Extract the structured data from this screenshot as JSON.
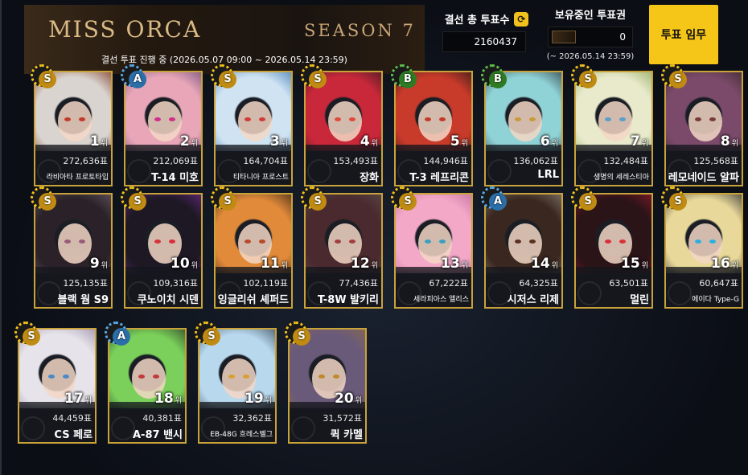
{
  "banner": {
    "logo": "MISS ORCA",
    "season": "SEASON 7",
    "period": "결선 투표 진행 중 (2026.05.07 09:00 ~ 2026.05.14 23:59)"
  },
  "totals": {
    "label": "결선 총 투표수",
    "value": "2160437"
  },
  "tickets": {
    "label": "보유중인 투표권",
    "count": "0",
    "expiry": "(~ 2026.05.14 23:59)"
  },
  "mission_button": "투표 임무",
  "rank_suffix": "위",
  "candidates": [
    {
      "rank": "1",
      "votes": "272,636표",
      "name": "라비아타 프로토타입",
      "grade": "S",
      "hair": "#d9d4cf",
      "accent": "#7a3520",
      "eye": "#c23a2a"
    },
    {
      "rank": "2",
      "votes": "212,069표",
      "name": "T-14 미호",
      "grade": "A",
      "hair": "#e8a6b8",
      "accent": "#6b4a7a",
      "eye": "#d02f8a"
    },
    {
      "rank": "3",
      "votes": "164,704표",
      "name": "티타니아 프로스트",
      "grade": "S",
      "hair": "#cfe3f3",
      "accent": "#3d78b0",
      "eye": "#d03a3a"
    },
    {
      "rank": "4",
      "votes": "153,493표",
      "name": "장화",
      "grade": "S",
      "hair": "#c8283a",
      "accent": "#3a1a22",
      "eye": "#e04a3a"
    },
    {
      "rank": "5",
      "votes": "144,946표",
      "name": "T-3 레프리콘",
      "grade": "B",
      "hair": "#c83a2a",
      "accent": "#2a1a16",
      "eye": "#c43a2a"
    },
    {
      "rank": "6",
      "votes": "136,062표",
      "name": "LRL",
      "grade": "B",
      "hair": "#8fd3d6",
      "accent": "#2c3a40",
      "eye": "#c89a3a"
    },
    {
      "rank": "7",
      "votes": "132,484표",
      "name": "생명의 세레스티아",
      "grade": "S",
      "hair": "#e8eacb",
      "accent": "#8fa85a",
      "eye": "#5aa0c8"
    },
    {
      "rank": "8",
      "votes": "125,568표",
      "name": "레모네이드 알파",
      "grade": "S",
      "hair": "#7b4a6a",
      "accent": "#3a2a2e",
      "eye": "#7a3a3a"
    },
    {
      "rank": "9",
      "votes": "125,135표",
      "name": "블랙 웜 S9",
      "grade": "S",
      "hair": "#2a2228",
      "accent": "#6a5a66",
      "eye": "#9a5a7a"
    },
    {
      "rank": "10",
      "votes": "109,316표",
      "name": "쿠노이치 시덴",
      "grade": "S",
      "hair": "#1e1824",
      "accent": "#6a2a8a",
      "eye": "#d8303a"
    },
    {
      "rank": "11",
      "votes": "102,119표",
      "name": "잉글리쉬 셰퍼드",
      "grade": "S",
      "hair": "#e08a3a",
      "accent": "#3a2418",
      "eye": "#b84a2a"
    },
    {
      "rank": "12",
      "votes": "77,436표",
      "name": "T-8W 발키리",
      "grade": "S",
      "hair": "#4a2a2e",
      "accent": "#5a4a4a",
      "eye": "#a04040"
    },
    {
      "rank": "13",
      "votes": "67,222표",
      "name": "세라피아스 앨리스",
      "grade": "S",
      "hair": "#f3a8c8",
      "accent": "#c06a9a",
      "eye": "#3aa0c0"
    },
    {
      "rank": "14",
      "votes": "64,325표",
      "name": "시저스 리제",
      "grade": "A",
      "hair": "#3a2820",
      "accent": "#8a8070",
      "eye": "#5a3020"
    },
    {
      "rank": "15",
      "votes": "63,501표",
      "name": "멀린",
      "grade": "S",
      "hair": "#2a1418",
      "accent": "#8a1a2a",
      "eye": "#d8303a"
    },
    {
      "rank": "16",
      "votes": "60,647표",
      "name": "에이다 Type-G",
      "grade": "S",
      "hair": "#e8d89a",
      "accent": "#2a2a2e",
      "eye": "#2ab0e0"
    },
    {
      "rank": "17",
      "votes": "44,459표",
      "name": "CS 페로",
      "grade": "S",
      "hair": "#e6e4ea",
      "accent": "#9a8aaa",
      "eye": "#4a88c8"
    },
    {
      "rank": "18",
      "votes": "40,381표",
      "name": "A-87 밴시",
      "grade": "A",
      "hair": "#7ad05a",
      "accent": "#2a3a24",
      "eye": "#c03a3a"
    },
    {
      "rank": "19",
      "votes": "32,362표",
      "name": "EB-48G 흐레스벨그",
      "grade": "S",
      "hair": "#b8d8ee",
      "accent": "#3a4a5a",
      "eye": "#d8a030"
    },
    {
      "rank": "20",
      "votes": "31,572표",
      "name": "퀵 카멜",
      "grade": "S",
      "hair": "#6a5a7a",
      "accent": "#8a6a4a",
      "eye": "#c0882a"
    }
  ]
}
